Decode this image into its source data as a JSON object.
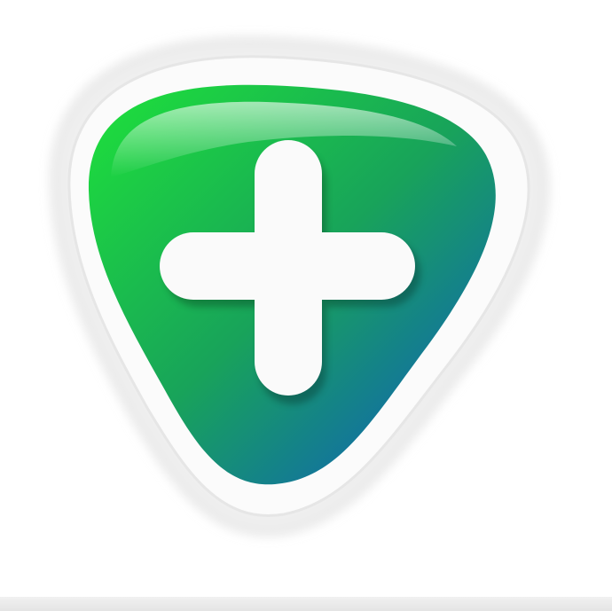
{
  "icon": {
    "name": "plus-shield-app-icon",
    "colors": {
      "gradient_start": "#1ee23a",
      "gradient_mid": "#18a35a",
      "gradient_end": "#0f55c9",
      "cross": "#fafafa",
      "outline": "#e2e2e2",
      "background": "#ffffff"
    }
  }
}
